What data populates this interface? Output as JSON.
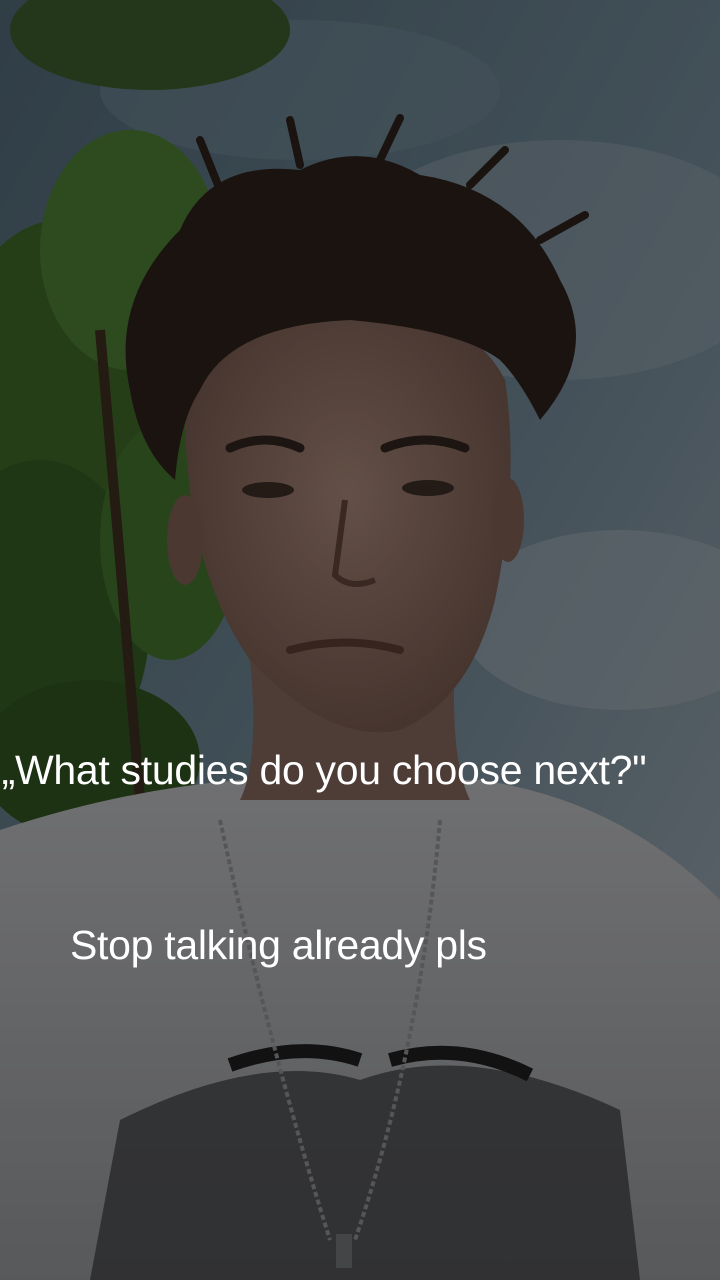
{
  "caption": {
    "quote": "„What studies do you choose next?\"",
    "reply": "Stop talking already pls"
  },
  "scene": {
    "sky_color": "#5f7585",
    "foliage_color": "#3f6a2a",
    "shirt_color": "#a7a8aa",
    "hair_color": "#2a1f1a",
    "skin_color": "#8d6f63"
  }
}
